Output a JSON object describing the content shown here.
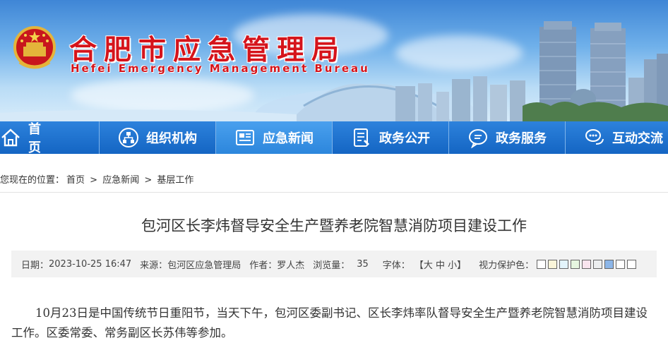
{
  "header": {
    "title": "合肥市应急管理局",
    "subtitle": "Hefei Emergency Management Bureau"
  },
  "nav": {
    "items": [
      {
        "label": "首　页",
        "icon": "home-icon"
      },
      {
        "label": "组织机构",
        "icon": "org-chart-icon"
      },
      {
        "label": "应急新闻",
        "icon": "news-icon"
      },
      {
        "label": "政务公开",
        "icon": "document-icon"
      },
      {
        "label": "政务服务",
        "icon": "chat-bubble-icon"
      },
      {
        "label": "互动交流",
        "icon": "speech-bubbles-icon"
      }
    ],
    "active_index": 2
  },
  "breadcrumb": {
    "prefix": "您现在的位置：",
    "home": "首页",
    "sep": ">",
    "section": "应急新闻",
    "current": "基层工作"
  },
  "article": {
    "title": "包河区长李炜督导安全生产暨养老院智慧消防项目建设工作",
    "meta": {
      "date_label": "日期：",
      "date": "2023-10-25 16:47",
      "source_label": "来源：",
      "source": "包河区应急管理局",
      "author_label": "作者：",
      "author": "罗人杰",
      "views_label": "浏览量：",
      "views": "35",
      "font_label": "字体：",
      "font_open": "【",
      "font_large": "大",
      "font_medium": "中",
      "font_small": "小",
      "font_close": "】",
      "vision_label": "视力保护色：",
      "vision_colors": [
        "#ffffff",
        "#faf5d9",
        "#e3f4fb",
        "#e6f6e0",
        "#f9e4ee",
        "#eceeef",
        "#8cb6e8",
        "#ffffff",
        "#ffffff"
      ]
    },
    "body": "10月23日是中国传统节日重阳节，当天下午，包河区委副书记、区长李炜率队督导安全生产暨养老院智慧消防项目建设工作。区委常委、常务副区长苏伟等参加。"
  },
  "colors": {
    "brand_red": "#d5141b",
    "nav_blue": "#1465c3",
    "nav_active": "#2c86dc"
  }
}
